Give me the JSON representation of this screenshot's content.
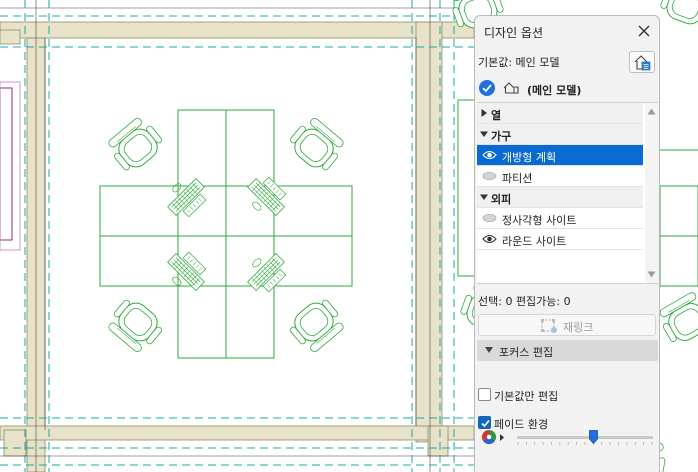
{
  "panel": {
    "title": "디자인 옵션",
    "default_label": "기본값: 메인 모델",
    "model_label": "(메인 모델)",
    "tree": [
      {
        "type": "group",
        "label": "열",
        "expanded": false
      },
      {
        "type": "group",
        "label": "가구",
        "expanded": true
      },
      {
        "type": "item",
        "label": "개방형 계획",
        "visible": true,
        "selected": true
      },
      {
        "type": "item",
        "label": "파티션",
        "visible": false,
        "selected": false
      },
      {
        "type": "group",
        "label": "외피",
        "expanded": true
      },
      {
        "type": "item",
        "label": "정사각형 사이트",
        "visible": false,
        "selected": false
      },
      {
        "type": "item",
        "label": "라운드 사이트",
        "visible": true,
        "selected": false
      }
    ],
    "selection_info": "선택: 0 편집가능: 0",
    "relink_label": "재링크",
    "focus_edit_label": "포커스 편집",
    "default_only_label": "기본값만 편집",
    "default_only_checked": false,
    "fade_label": "페이드 환경",
    "fade_checked": true,
    "fade_level": 0.56
  },
  "colors": {
    "accent": "#0a6ad4",
    "furniture": "#2eaa3a",
    "guide": "#1aa8a0",
    "wall": "#e8e3c8"
  }
}
